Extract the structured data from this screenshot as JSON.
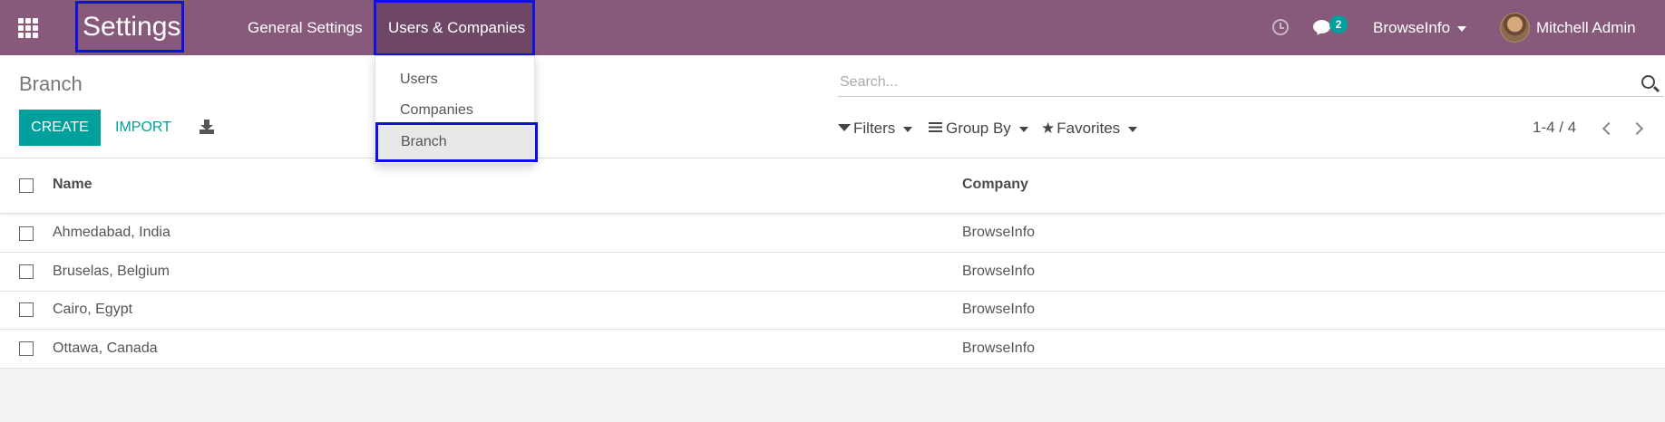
{
  "navbar": {
    "app_title": "Settings",
    "menu": [
      "General Settings",
      "Users & Companies"
    ],
    "messages_count": "2",
    "company": "BrowseInfo",
    "user": "Mitchell Admin",
    "bg_color": "#875a7b"
  },
  "dropdown": {
    "items": [
      "Users",
      "Companies",
      "Branch"
    ]
  },
  "control_panel": {
    "breadcrumb": "Branch",
    "create_label": "CREATE",
    "import_label": "IMPORT",
    "search_placeholder": "Search...",
    "filters_label": "Filters",
    "groupby_label": "Group By",
    "favorites_label": "Favorites",
    "pager": "1-4 / 4",
    "accent_color": "#00a09d"
  },
  "table": {
    "columns": [
      "Name",
      "Company"
    ],
    "rows": [
      {
        "name": "Ahmedabad, India",
        "company": "BrowseInfo"
      },
      {
        "name": "Bruselas, Belgium",
        "company": "BrowseInfo"
      },
      {
        "name": "Cairo, Egypt",
        "company": "BrowseInfo"
      },
      {
        "name": "Ottawa, Canada",
        "company": "BrowseInfo"
      }
    ]
  }
}
